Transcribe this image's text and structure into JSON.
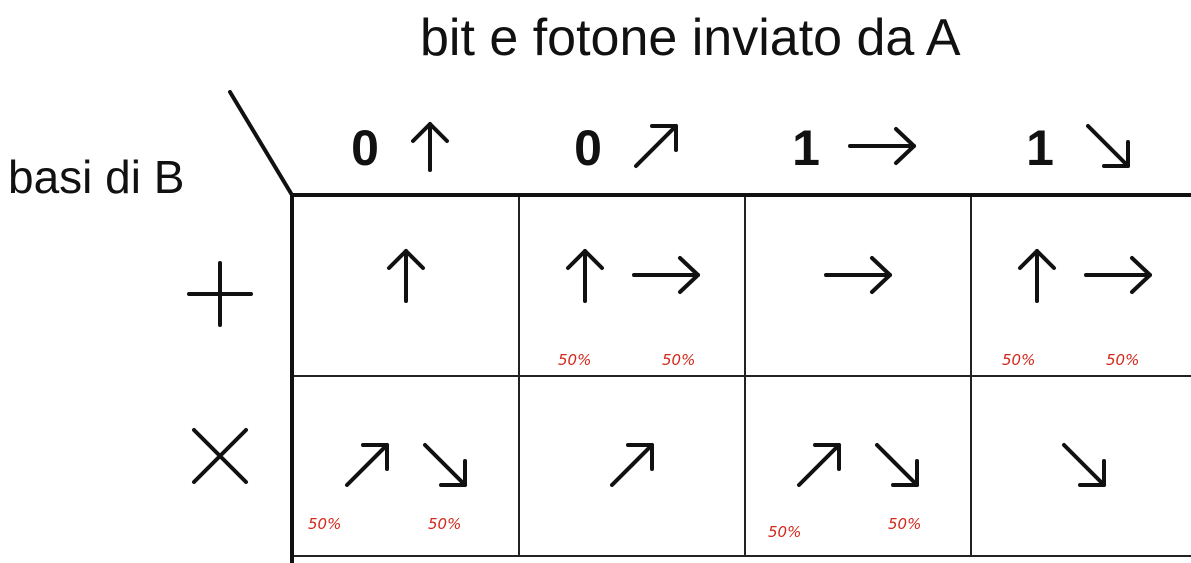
{
  "title": "bit e fotone inviato da A",
  "row_header_title": "basi di B",
  "columns": [
    {
      "bit": "0",
      "photon": "arrow-up"
    },
    {
      "bit": "0",
      "photon": "arrow-up-right"
    },
    {
      "bit": "1",
      "photon": "arrow-right"
    },
    {
      "bit": "1",
      "photon": "arrow-down-right"
    }
  ],
  "rows": [
    {
      "basis": "plus-basis"
    },
    {
      "basis": "cross-basis"
    }
  ],
  "cells": {
    "r0c0": {
      "arrows": [
        "arrow-up"
      ],
      "pcts": []
    },
    "r0c1": {
      "arrows": [
        "arrow-up",
        "arrow-right"
      ],
      "pcts": [
        "50%",
        "50%"
      ]
    },
    "r0c2": {
      "arrows": [
        "arrow-right"
      ],
      "pcts": []
    },
    "r0c3": {
      "arrows": [
        "arrow-up",
        "arrow-right"
      ],
      "pcts": [
        "50%",
        "50%"
      ]
    },
    "r1c0": {
      "arrows": [
        "arrow-up-right",
        "arrow-down-right"
      ],
      "pcts": [
        "50%",
        "50%"
      ]
    },
    "r1c1": {
      "arrows": [
        "arrow-up-right"
      ],
      "pcts": []
    },
    "r1c2": {
      "arrows": [
        "arrow-up-right",
        "arrow-down-right"
      ],
      "pcts": [
        "50%",
        "50%"
      ]
    },
    "r1c3": {
      "arrows": [
        "arrow-down-right"
      ],
      "pcts": []
    }
  },
  "colors": {
    "ink": "#111111",
    "percent": "#d4281c",
    "background": "#ffffff"
  }
}
